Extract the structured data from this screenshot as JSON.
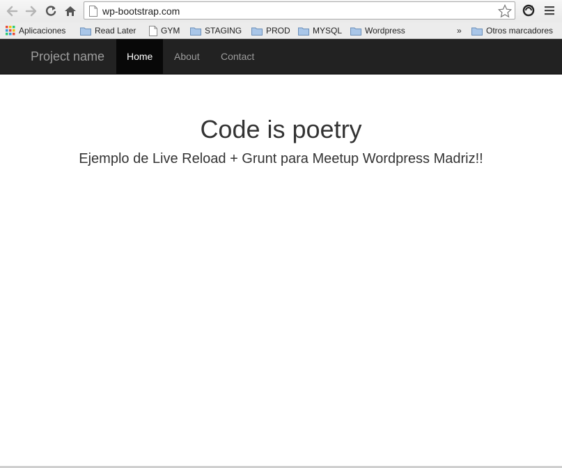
{
  "browser": {
    "url": "wp-bootstrap.com",
    "icons": {
      "back": "back-arrow-icon",
      "forward": "forward-arrow-icon",
      "reload": "reload-icon",
      "home": "home-icon",
      "page": "page-icon",
      "star": "star-icon",
      "extension": "extension-icon",
      "menu": "menu-icon"
    }
  },
  "bookmarks": {
    "apps": "Aplicaciones",
    "items": [
      "Read Later",
      "GYM",
      "STAGING",
      "PROD",
      "MYSQL",
      "Wordpress"
    ],
    "more": "»",
    "other": "Otros marcadores"
  },
  "navbar": {
    "brand": "Project name",
    "links": [
      "Home",
      "About",
      "Contact"
    ],
    "active": "Home"
  },
  "hero": {
    "title": "Code is poetry",
    "subtitle": "Ejemplo de Live Reload + Grunt para Meetup Wordpress Madriz!!"
  },
  "colors": {
    "navbar_bg": "#222222",
    "navbar_active_bg": "#080808",
    "navbar_text": "#9d9d9d",
    "heading": "#333333"
  }
}
